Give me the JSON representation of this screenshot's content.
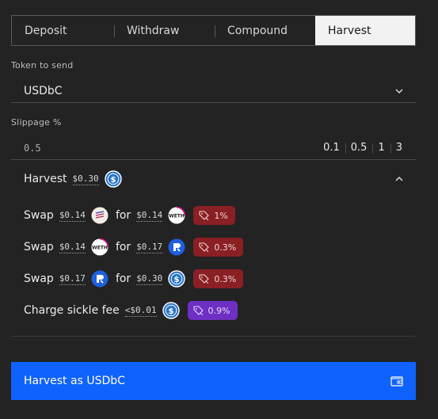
{
  "tabs": [
    {
      "label": "Deposit",
      "active": false
    },
    {
      "label": "Withdraw",
      "active": false
    },
    {
      "label": "Compound",
      "active": false
    },
    {
      "label": "Harvest",
      "active": true
    }
  ],
  "token": {
    "label": "Token to send",
    "selected": "USDbC"
  },
  "slippage": {
    "label": "Slippage %",
    "placeholder": "0.5",
    "presets": [
      "0.1",
      "0.5",
      "1",
      "3"
    ]
  },
  "harvest": {
    "title": "Harvest",
    "amount": "$0.30",
    "token_icon": "usdc-coin-icon"
  },
  "steps": [
    {
      "action": "Swap",
      "from_amount": "$0.14",
      "from_icon": "sickle-token-icon",
      "connector": "for",
      "to_amount": "$0.14",
      "to_icon": "weth-coin-icon",
      "fee": "1%",
      "fee_color": "#8a1f24"
    },
    {
      "action": "Swap",
      "from_amount": "$0.14",
      "from_icon": "weth-coin-icon",
      "connector": "for",
      "to_amount": "$0.17",
      "to_icon": "blue-token-icon",
      "fee": "0.3%",
      "fee_color": "#8a1f24"
    },
    {
      "action": "Swap",
      "from_amount": "$0.17",
      "from_icon": "blue-token-icon",
      "connector": "for",
      "to_amount": "$0.30",
      "to_icon": "usdc-coin-icon",
      "fee": "0.3%",
      "fee_color": "#8a1f24"
    }
  ],
  "charge": {
    "label": "Charge sickle fee",
    "amount": "<$0.01",
    "icon": "usdc-coin-icon",
    "fee": "0.9%",
    "fee_color": "#6e2fc4"
  },
  "cta": {
    "label": "Harvest as USDbC",
    "icon": "wallet-icon"
  },
  "colors": {
    "accent": "#0f62fe",
    "background": "#232323",
    "fee_red": "#8a1f24",
    "fee_purple": "#6e2fc4"
  }
}
